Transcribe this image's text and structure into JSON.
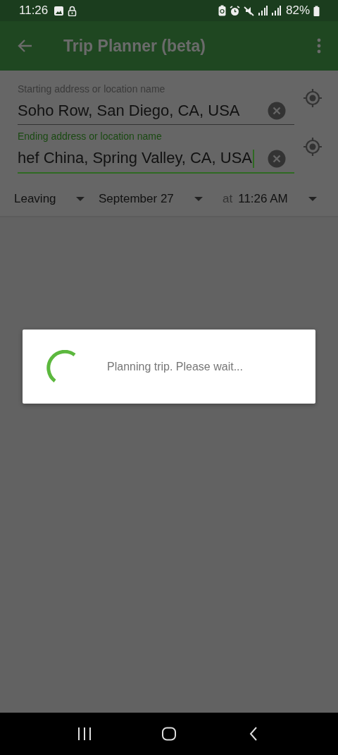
{
  "status_bar": {
    "time": "11:26",
    "battery": "82%"
  },
  "app_bar": {
    "title": "Trip Planner (beta)"
  },
  "fields": [
    {
      "label": "Starting address or location name",
      "value": "Soho Row, San Diego, CA, USA",
      "focused": false
    },
    {
      "label": "Ending address or location name",
      "value": "hef China, Spring Valley, CA, USA",
      "focused": true
    }
  ],
  "options": {
    "mode": "Leaving",
    "date": "September 27",
    "at": "at",
    "time": "11:26 AM"
  },
  "dialog": {
    "message": "Planning trip. Please wait..."
  }
}
